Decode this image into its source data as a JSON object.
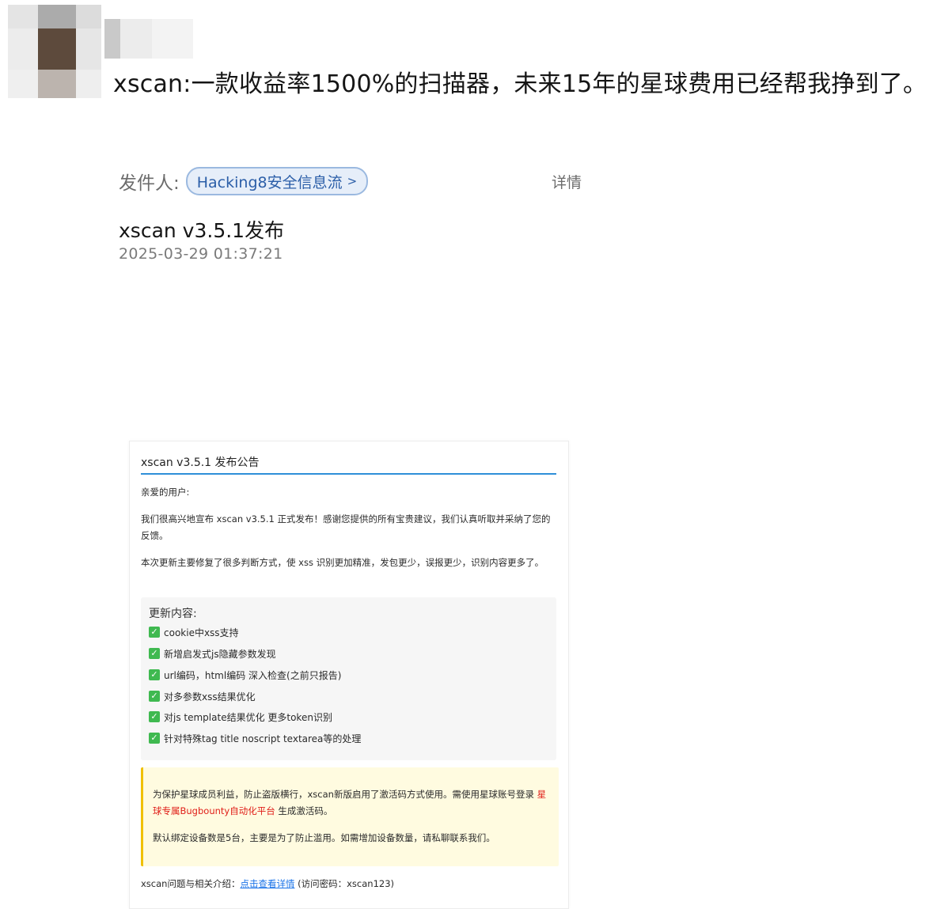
{
  "article": {
    "title": "xscan:一款收益率1500%的扫描器，未来15年的星球费用已经帮我挣到了。"
  },
  "meta": {
    "sender_label": "发件人:",
    "sender_name": "Hacking8安全信息流",
    "sender_chevron": ">",
    "details_label": "详情"
  },
  "post": {
    "title": "xscan v3.5.1发布",
    "timestamp": "2025-03-29 01:37:21"
  },
  "card": {
    "header": "xscan v3.5.1 发布公告",
    "greeting": "亲爱的用户:",
    "para1": "我们很高兴地宣布 xscan v3.5.1 正式发布！感谢您提供的所有宝贵建议，我们认真听取并采纳了您的反馈。",
    "para2": "本次更新主要修复了很多判断方式，使 xss 识别更加精准，发包更少，误报更少，识别内容更多了。",
    "updates_title": "更新内容:",
    "updates": [
      "cookie中xss支持",
      "新增启发式js隐藏参数发现",
      "url编码，html编码 深入检查(之前只报告)",
      "对多参数xss结果优化",
      "对js template结果优化 更多token识别",
      "针对特殊tag title noscript textarea等的处理"
    ],
    "notice": {
      "line1_prefix": "为保护星球成员利益，防止盗版横行，xscan新版启用了激活码方式使用。需使用星球账号登录 ",
      "line1_link": "星球专属Bugbounty自动化平台",
      "line1_suffix": " 生成激活码。",
      "line2": "默认绑定设备数是5台，主要是为了防止滥用。如需增加设备数量，请私聊联系我们。"
    },
    "footer": {
      "prefix": "xscan问题与相关介绍：",
      "link": "点击查看详情",
      "suffix": " (访问密码：xscan123)"
    }
  },
  "colors": {
    "accent_blue": "#2f8fd8",
    "link_blue": "#1a73e8",
    "link_red": "#e0201a",
    "check_green": "#3fb950",
    "notice_yellow": "#f0c000"
  }
}
